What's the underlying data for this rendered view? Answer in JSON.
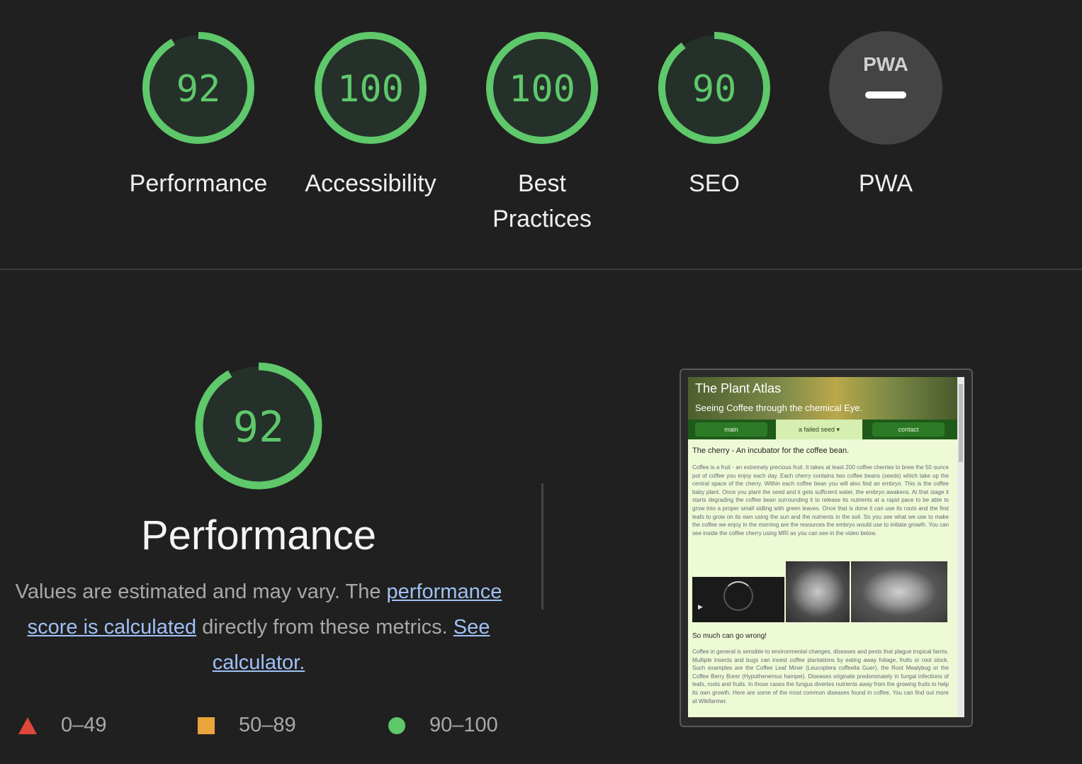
{
  "categories": [
    {
      "label": "Performance",
      "score": "92",
      "fraction": 0.92
    },
    {
      "label": "Accessibility",
      "score": "100",
      "fraction": 1.0
    },
    {
      "label": "Best Practices",
      "score": "100",
      "fraction": 1.0
    },
    {
      "label": "SEO",
      "score": "90",
      "fraction": 0.9
    },
    {
      "label": "PWA",
      "score": "",
      "badge": "PWA"
    }
  ],
  "performance": {
    "score": "92",
    "fraction": 0.92,
    "title": "Performance",
    "desc_prefix": "Values are estimated and may vary. The ",
    "score_link": "performance score is calculated",
    "desc_middle": " directly from these metrics. ",
    "calculator_link": "See calculator."
  },
  "legend": [
    {
      "range": "0–49",
      "color": "#e0463a"
    },
    {
      "range": "50–89",
      "color": "#e9a43d"
    },
    {
      "range": "90–100",
      "color": "#5ec86a"
    }
  ],
  "colors": {
    "pass": "#5ec86a",
    "gauge_bg": "#25302a",
    "pwa_bg": "#444444"
  },
  "screenshot": {
    "site_title": "The Plant Atlas",
    "site_subtitle": "Seeing Coffee through the chemical Eye.",
    "nav": [
      "main",
      "a failed seed ▾",
      "contact"
    ],
    "heading1": "The cherry - An incubator for the coffee bean.",
    "para1": "Coffee is a fruit - an extremely precious fruit. It takes at least 200 coffee cherries to brew the 50 ounce pot of coffee you enjoy each day. Each cherry contains two coffee beans (seeds) which take up the central space of the cherry. Within each coffee bean you will also find an embryo. This is the coffee baby plant. Once you plant the seed and it gets sufficient water, the embryo awakens. At that stage it starts degrading the coffee bean surrounding it to release its nutrients at a rapid pace to be able to grow into a proper small sidling with green leaves. Once that is done it can use its roots and the first leafs to grow on its own using the sun and the nutrients in the soil. So you see what we use to make the coffee we enjoy in the morning are the resources the embryo would use to initiate growth. You can see inside the coffee cherry using MRI as you can see in the video below.",
    "heading2": "So much can go wrong!",
    "para2": "Coffee in general is sensible to environmental changes, diseases and pests that plague tropical farms. Multiple insects and bugs can invest coffee plantations by eating away foliage, fruits or root stock. Such examples are the Coffee Leaf Miner (Leucoptera coffeella Guer), the Root Mealybug or the Coffee Berry Borer (Hypothenemus hampei). Diseases originate predominately in fungal infections of leafs, roots and fruits. In those cases the fungus divertes nutrients away from the growing fruits to help its own growth. Here are some of the most common diseases found in coffee. You can find out more at Wikifarmer."
  }
}
